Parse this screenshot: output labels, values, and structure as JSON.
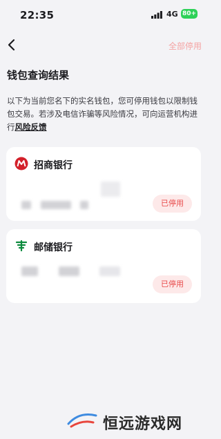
{
  "status_bar": {
    "time": "22:35",
    "network": "4G",
    "battery": "80+"
  },
  "nav": {
    "stop_all_label": "全部停用"
  },
  "page": {
    "title": "钱包查询结果",
    "description": "以下为当前您名下的实名钱包，您可停用钱包以限制钱包交易。若涉及电信诈骗等风险情况，可向运营机构进行",
    "risk_link": "风险反馈"
  },
  "wallets": [
    {
      "bank": "招商银行",
      "logo_icon": "cmb-logo-icon",
      "stop_label": "已停用"
    },
    {
      "bank": "邮储银行",
      "logo_icon": "psbc-logo-icon",
      "stop_label": "已停用"
    }
  ],
  "watermark": {
    "text": "恒远游戏网"
  },
  "colors": {
    "accent_red": "#e84a4a",
    "stop_all": "#f4a3a3",
    "battery": "#2ed158"
  }
}
